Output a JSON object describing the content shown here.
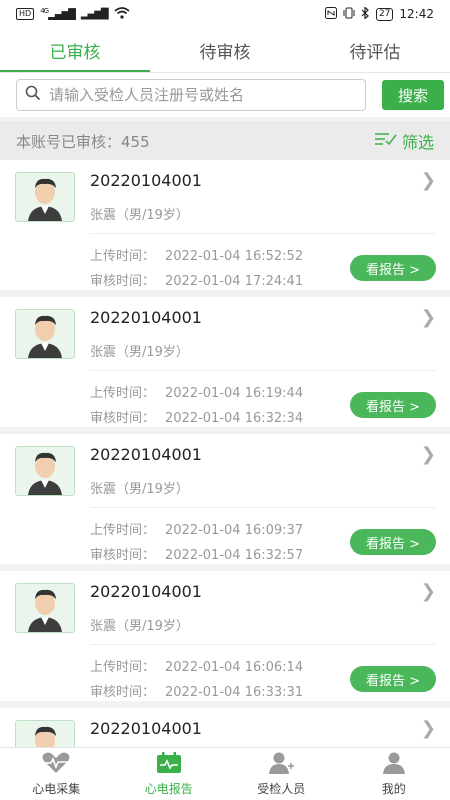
{
  "status": {
    "hd": "HD",
    "signal": "4G",
    "battery": "27",
    "time": "12:42"
  },
  "tabs": [
    {
      "label": "已审核",
      "active": true
    },
    {
      "label": "待审核",
      "active": false
    },
    {
      "label": "待评估",
      "active": false
    }
  ],
  "search": {
    "placeholder": "请输入受检人员注册号或姓名",
    "value": "",
    "button_label": "搜索"
  },
  "summary": {
    "label": "本账号已审核：",
    "count": "455",
    "filter_label": "筛选"
  },
  "labels": {
    "upload": "上传时间：",
    "review": "审核时间：",
    "view_report": "看报告 >"
  },
  "records": [
    {
      "reg_no": "20220104001",
      "person": "张震（男/19岁）",
      "upload_time": "2022-01-04 16:52:52",
      "review_time": "2022-01-04 17:24:41"
    },
    {
      "reg_no": "20220104001",
      "person": "张震（男/19岁）",
      "upload_time": "2022-01-04 16:19:44",
      "review_time": "2022-01-04 16:32:34"
    },
    {
      "reg_no": "20220104001",
      "person": "张震（男/19岁）",
      "upload_time": "2022-01-04 16:09:37",
      "review_time": "2022-01-04 16:32:57"
    },
    {
      "reg_no": "20220104001",
      "person": "张震（男/19岁）",
      "upload_time": "2022-01-04 16:06:14",
      "review_time": "2022-01-04 16:33:31"
    },
    {
      "reg_no": "20220104001",
      "person": "",
      "upload_time": "",
      "review_time": ""
    }
  ],
  "nav": [
    {
      "label": "心电采集",
      "icon": "heartbeat-icon",
      "active": false
    },
    {
      "label": "心电报告",
      "icon": "report-calendar-icon",
      "active": true
    },
    {
      "label": "受检人员",
      "icon": "person-add-icon",
      "active": false
    },
    {
      "label": "我的",
      "icon": "user-icon",
      "active": false
    }
  ],
  "colors": {
    "accent": "#3bb04a"
  }
}
